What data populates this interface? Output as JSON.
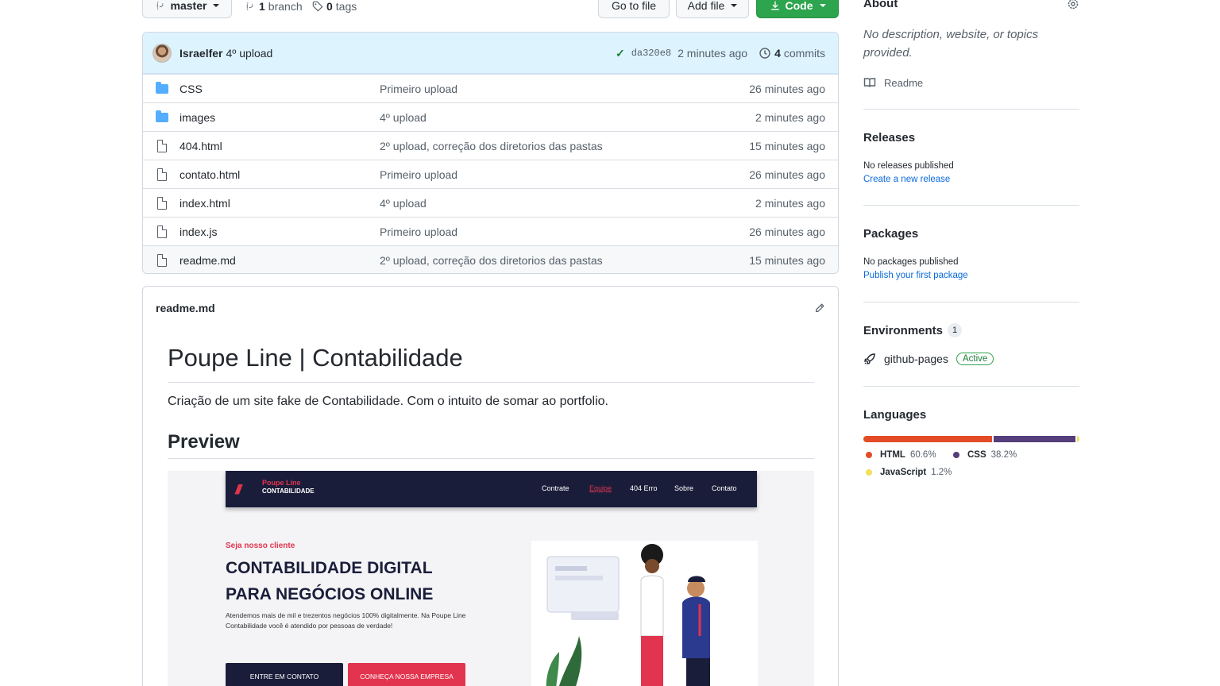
{
  "toolbar": {
    "branch_selector": "master",
    "branch_count": "1",
    "branch_label": "branch",
    "tag_count": "0",
    "tag_label": "tags",
    "go_to_file": "Go to file",
    "add_file": "Add file",
    "code": "Code"
  },
  "commit": {
    "author": "Israelfer",
    "message": "4º upload",
    "sha": "da320e8",
    "time": "2 minutes ago",
    "commit_count": "4",
    "commit_label": "commits"
  },
  "files": [
    {
      "type": "folder",
      "name": "CSS",
      "message": "Primeiro upload",
      "age": "26 minutes ago"
    },
    {
      "type": "folder",
      "name": "images",
      "message": "4º upload",
      "age": "2 minutes ago"
    },
    {
      "type": "file",
      "name": "404.html",
      "message": "2º upload, correção dos diretorios das pastas",
      "age": "15 minutes ago"
    },
    {
      "type": "file",
      "name": "contato.html",
      "message": "Primeiro upload",
      "age": "26 minutes ago"
    },
    {
      "type": "file",
      "name": "index.html",
      "message": "4º upload",
      "age": "2 minutes ago"
    },
    {
      "type": "file",
      "name": "index.js",
      "message": "Primeiro upload",
      "age": "26 minutes ago"
    },
    {
      "type": "file",
      "name": "readme.md",
      "message": "2º upload, correção dos diretorios das pastas",
      "age": "15 minutes ago"
    }
  ],
  "readme": {
    "filename": "readme.md",
    "h1": "Poupe Line | Contabilidade",
    "paragraph": "Criação de um site fake de Contabilidade. Com o intuito de somar ao portfolio.",
    "h2": "Preview"
  },
  "preview": {
    "brand_top": "Poupe Line",
    "brand_bottom": "CONTABILIDADE",
    "menu": [
      "Contrate",
      "Equipe",
      "404 Erro",
      "Sobre",
      "Contato"
    ],
    "eyebrow": "Seja nosso cliente",
    "title": "CONTABILIDADE DIGITAL PARA NEGÓCIOS ONLINE",
    "description": "Atendemos mais de mil e trezentos negócios 100% digitalmente. Na Poupe Line Contabilidade você é atendido por pessoas de verdade!",
    "button_primary": "ENTRE EM CONTATO",
    "button_secondary": "CONHEÇA NOSSA EMPRESA",
    "accent_color": "#e2344e",
    "nav_color": "#1a1d3a"
  },
  "sidebar": {
    "about_title": "About",
    "about_desc": "No description, website, or topics provided.",
    "readme_link": "Readme",
    "releases_title": "Releases",
    "releases_none": "No releases published",
    "releases_link": "Create a new release",
    "packages_title": "Packages",
    "packages_none": "No packages published",
    "packages_link": "Publish your first package",
    "environments_title": "Environments",
    "environments_count": "1",
    "environment_name": "github-pages",
    "environment_status": "Active",
    "languages_title": "Languages",
    "languages": [
      {
        "name": "HTML",
        "percent": "60.6%",
        "value": 60.6,
        "color": "#e34c26"
      },
      {
        "name": "CSS",
        "percent": "38.2%",
        "value": 38.2,
        "color": "#563d7c"
      },
      {
        "name": "JavaScript",
        "percent": "1.2%",
        "value": 1.2,
        "color": "#f1e05a"
      }
    ]
  },
  "icons": [
    "branch-icon",
    "tag-icon",
    "download-icon",
    "check-icon",
    "history-icon",
    "folder-icon",
    "file-icon",
    "pencil-icon",
    "gear-icon",
    "book-icon",
    "rocket-icon"
  ]
}
